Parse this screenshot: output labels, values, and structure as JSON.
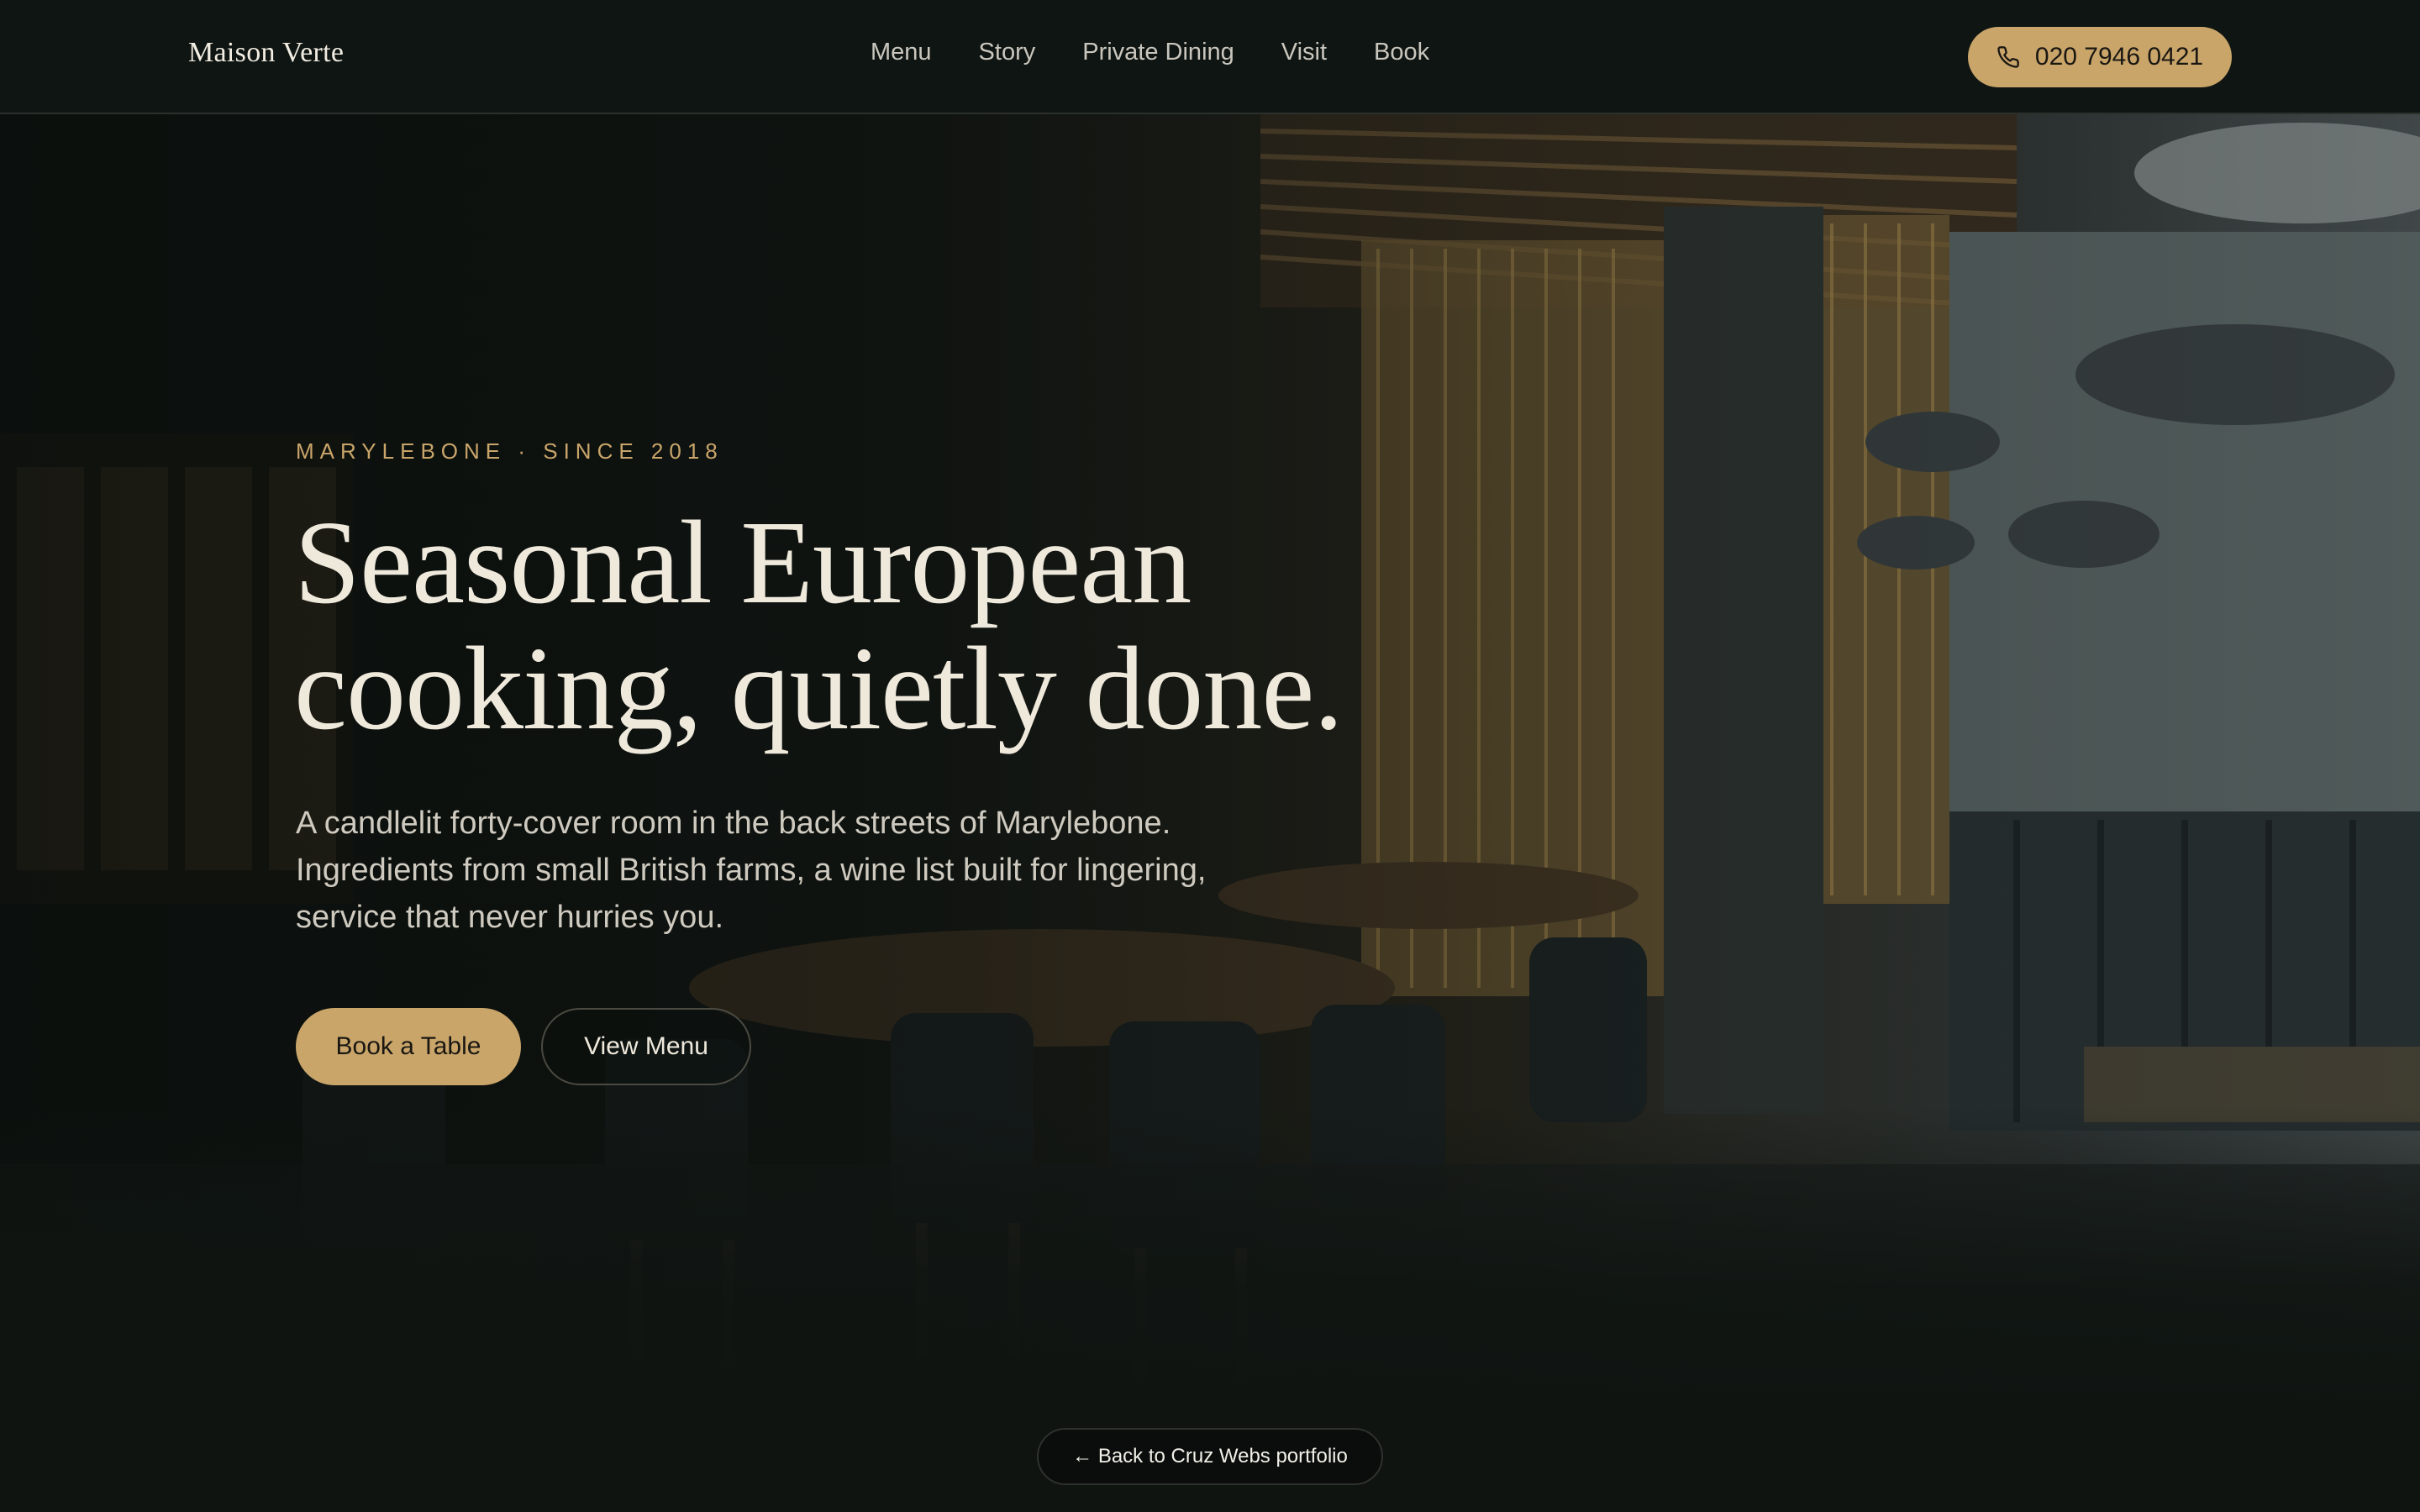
{
  "brand": {
    "name": "Maison Verte"
  },
  "nav": {
    "links": [
      "Menu",
      "Story",
      "Private Dining",
      "Visit",
      "Book"
    ],
    "phone": "020 7946 0421",
    "phone_icon": "phone-icon"
  },
  "hero": {
    "eyebrow": "MARYLEBONE · SINCE 2018",
    "headline_line1": "Seasonal European",
    "headline_line2": "cooking, quietly done.",
    "lede": "A candlelit forty-cover room in the back streets of Marylebone. Ingredients from small British farms, a wine list built for lingering, service that never hurries you.",
    "primary_cta": "Book a Table",
    "secondary_cta": "View Menu"
  },
  "footer": {
    "back_link": "← Back to Cruz Webs portfolio"
  },
  "colors": {
    "accent": "#c9a56a",
    "background": "#0f1411",
    "text": "#efe9dc"
  }
}
